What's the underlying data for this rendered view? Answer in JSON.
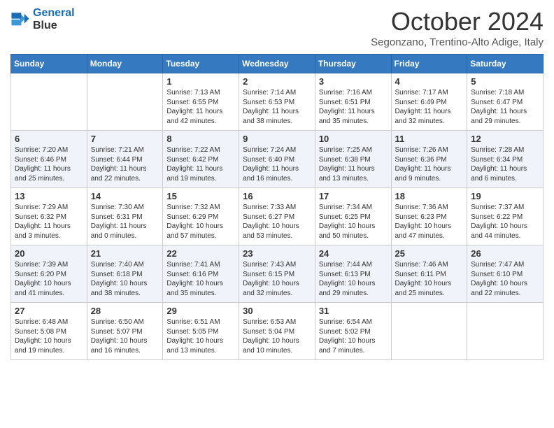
{
  "header": {
    "logo_line1": "General",
    "logo_line2": "Blue",
    "month": "October 2024",
    "location": "Segonzano, Trentino-Alto Adige, Italy"
  },
  "days_of_week": [
    "Sunday",
    "Monday",
    "Tuesday",
    "Wednesday",
    "Thursday",
    "Friday",
    "Saturday"
  ],
  "weeks": [
    [
      {
        "day": "",
        "info": ""
      },
      {
        "day": "",
        "info": ""
      },
      {
        "day": "1",
        "info": "Sunrise: 7:13 AM\nSunset: 6:55 PM\nDaylight: 11 hours and 42 minutes."
      },
      {
        "day": "2",
        "info": "Sunrise: 7:14 AM\nSunset: 6:53 PM\nDaylight: 11 hours and 38 minutes."
      },
      {
        "day": "3",
        "info": "Sunrise: 7:16 AM\nSunset: 6:51 PM\nDaylight: 11 hours and 35 minutes."
      },
      {
        "day": "4",
        "info": "Sunrise: 7:17 AM\nSunset: 6:49 PM\nDaylight: 11 hours and 32 minutes."
      },
      {
        "day": "5",
        "info": "Sunrise: 7:18 AM\nSunset: 6:47 PM\nDaylight: 11 hours and 29 minutes."
      }
    ],
    [
      {
        "day": "6",
        "info": "Sunrise: 7:20 AM\nSunset: 6:46 PM\nDaylight: 11 hours and 25 minutes."
      },
      {
        "day": "7",
        "info": "Sunrise: 7:21 AM\nSunset: 6:44 PM\nDaylight: 11 hours and 22 minutes."
      },
      {
        "day": "8",
        "info": "Sunrise: 7:22 AM\nSunset: 6:42 PM\nDaylight: 11 hours and 19 minutes."
      },
      {
        "day": "9",
        "info": "Sunrise: 7:24 AM\nSunset: 6:40 PM\nDaylight: 11 hours and 16 minutes."
      },
      {
        "day": "10",
        "info": "Sunrise: 7:25 AM\nSunset: 6:38 PM\nDaylight: 11 hours and 13 minutes."
      },
      {
        "day": "11",
        "info": "Sunrise: 7:26 AM\nSunset: 6:36 PM\nDaylight: 11 hours and 9 minutes."
      },
      {
        "day": "12",
        "info": "Sunrise: 7:28 AM\nSunset: 6:34 PM\nDaylight: 11 hours and 6 minutes."
      }
    ],
    [
      {
        "day": "13",
        "info": "Sunrise: 7:29 AM\nSunset: 6:32 PM\nDaylight: 11 hours and 3 minutes."
      },
      {
        "day": "14",
        "info": "Sunrise: 7:30 AM\nSunset: 6:31 PM\nDaylight: 11 hours and 0 minutes."
      },
      {
        "day": "15",
        "info": "Sunrise: 7:32 AM\nSunset: 6:29 PM\nDaylight: 10 hours and 57 minutes."
      },
      {
        "day": "16",
        "info": "Sunrise: 7:33 AM\nSunset: 6:27 PM\nDaylight: 10 hours and 53 minutes."
      },
      {
        "day": "17",
        "info": "Sunrise: 7:34 AM\nSunset: 6:25 PM\nDaylight: 10 hours and 50 minutes."
      },
      {
        "day": "18",
        "info": "Sunrise: 7:36 AM\nSunset: 6:23 PM\nDaylight: 10 hours and 47 minutes."
      },
      {
        "day": "19",
        "info": "Sunrise: 7:37 AM\nSunset: 6:22 PM\nDaylight: 10 hours and 44 minutes."
      }
    ],
    [
      {
        "day": "20",
        "info": "Sunrise: 7:39 AM\nSunset: 6:20 PM\nDaylight: 10 hours and 41 minutes."
      },
      {
        "day": "21",
        "info": "Sunrise: 7:40 AM\nSunset: 6:18 PM\nDaylight: 10 hours and 38 minutes."
      },
      {
        "day": "22",
        "info": "Sunrise: 7:41 AM\nSunset: 6:16 PM\nDaylight: 10 hours and 35 minutes."
      },
      {
        "day": "23",
        "info": "Sunrise: 7:43 AM\nSunset: 6:15 PM\nDaylight: 10 hours and 32 minutes."
      },
      {
        "day": "24",
        "info": "Sunrise: 7:44 AM\nSunset: 6:13 PM\nDaylight: 10 hours and 29 minutes."
      },
      {
        "day": "25",
        "info": "Sunrise: 7:46 AM\nSunset: 6:11 PM\nDaylight: 10 hours and 25 minutes."
      },
      {
        "day": "26",
        "info": "Sunrise: 7:47 AM\nSunset: 6:10 PM\nDaylight: 10 hours and 22 minutes."
      }
    ],
    [
      {
        "day": "27",
        "info": "Sunrise: 6:48 AM\nSunset: 5:08 PM\nDaylight: 10 hours and 19 minutes."
      },
      {
        "day": "28",
        "info": "Sunrise: 6:50 AM\nSunset: 5:07 PM\nDaylight: 10 hours and 16 minutes."
      },
      {
        "day": "29",
        "info": "Sunrise: 6:51 AM\nSunset: 5:05 PM\nDaylight: 10 hours and 13 minutes."
      },
      {
        "day": "30",
        "info": "Sunrise: 6:53 AM\nSunset: 5:04 PM\nDaylight: 10 hours and 10 minutes."
      },
      {
        "day": "31",
        "info": "Sunrise: 6:54 AM\nSunset: 5:02 PM\nDaylight: 10 hours and 7 minutes."
      },
      {
        "day": "",
        "info": ""
      },
      {
        "day": "",
        "info": ""
      }
    ]
  ]
}
